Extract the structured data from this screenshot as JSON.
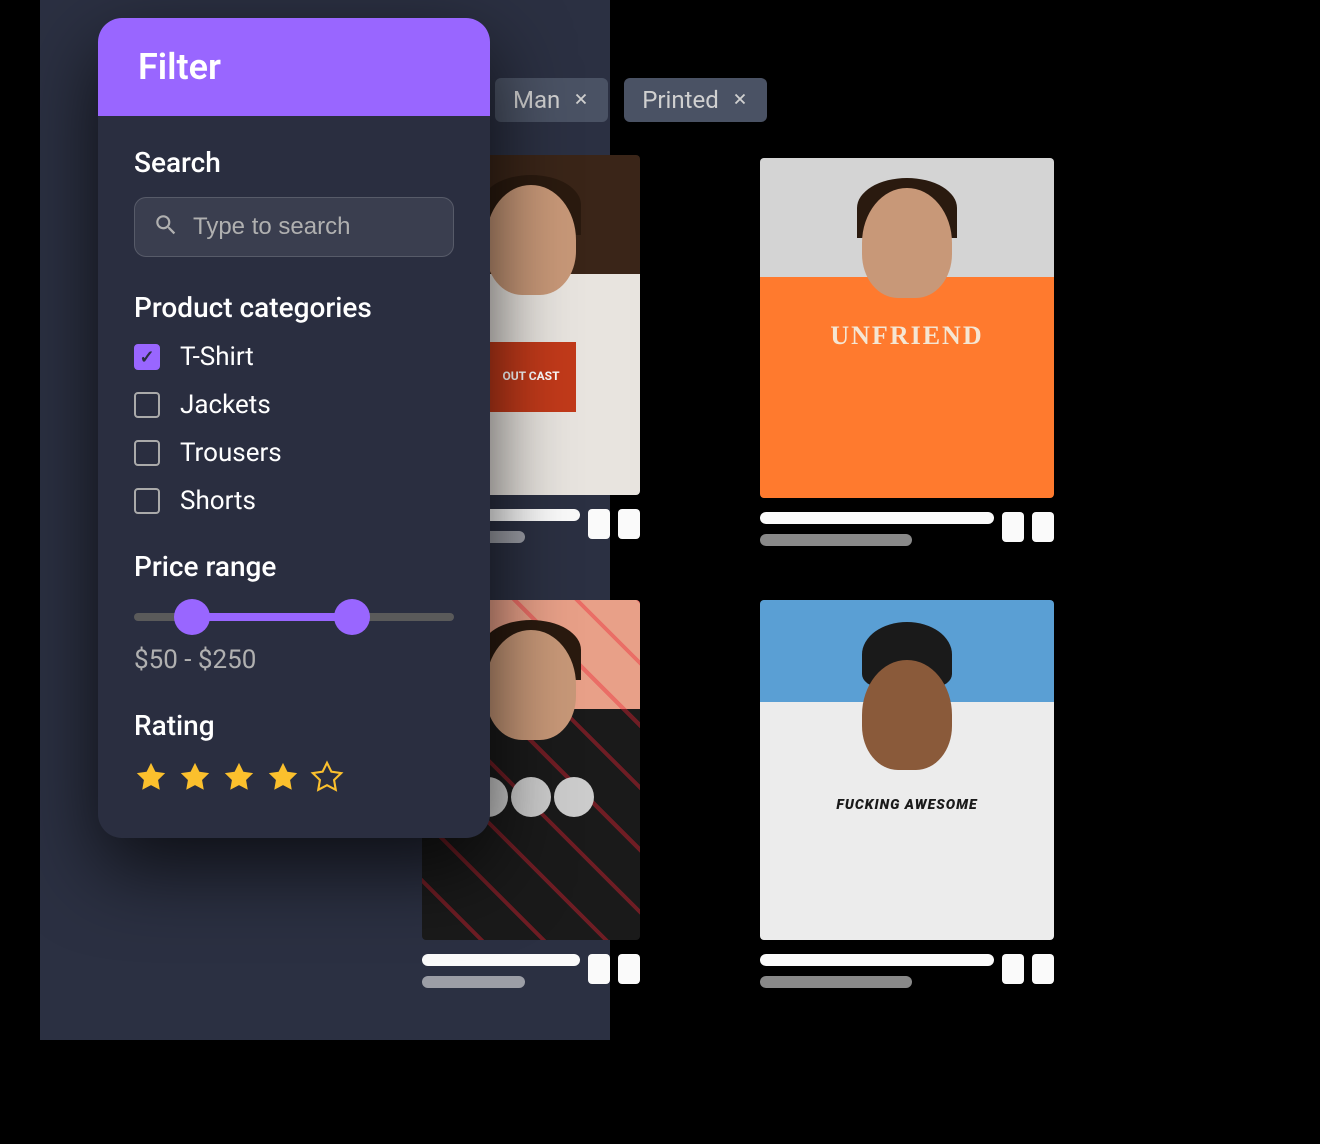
{
  "filter": {
    "title": "Filter",
    "search": {
      "label": "Search",
      "placeholder": "Type to search"
    },
    "categories": {
      "label": "Product categories",
      "items": [
        {
          "label": "T-Shirt",
          "checked": true
        },
        {
          "label": "Jackets",
          "checked": false
        },
        {
          "label": "Trousers",
          "checked": false
        },
        {
          "label": "Shorts",
          "checked": false
        }
      ]
    },
    "price": {
      "label": "Price range",
      "text": "$50 - $250",
      "min": 50,
      "max": 250
    },
    "rating": {
      "label": "Rating",
      "value": 4,
      "max": 5
    }
  },
  "chips": [
    {
      "label": "Man"
    },
    {
      "label": "Printed"
    }
  ],
  "products": [
    {
      "shirt_text": "OUT CAST"
    },
    {
      "shirt_text": "UNFRIEND"
    },
    {
      "shirt_text": ""
    },
    {
      "shirt_text": "FUCKING AWESOME"
    }
  ],
  "colors": {
    "accent": "#9966ff",
    "star": "#fbc02d",
    "chip_bg": "#4a5264",
    "panel_bg": "#2a2e40"
  }
}
